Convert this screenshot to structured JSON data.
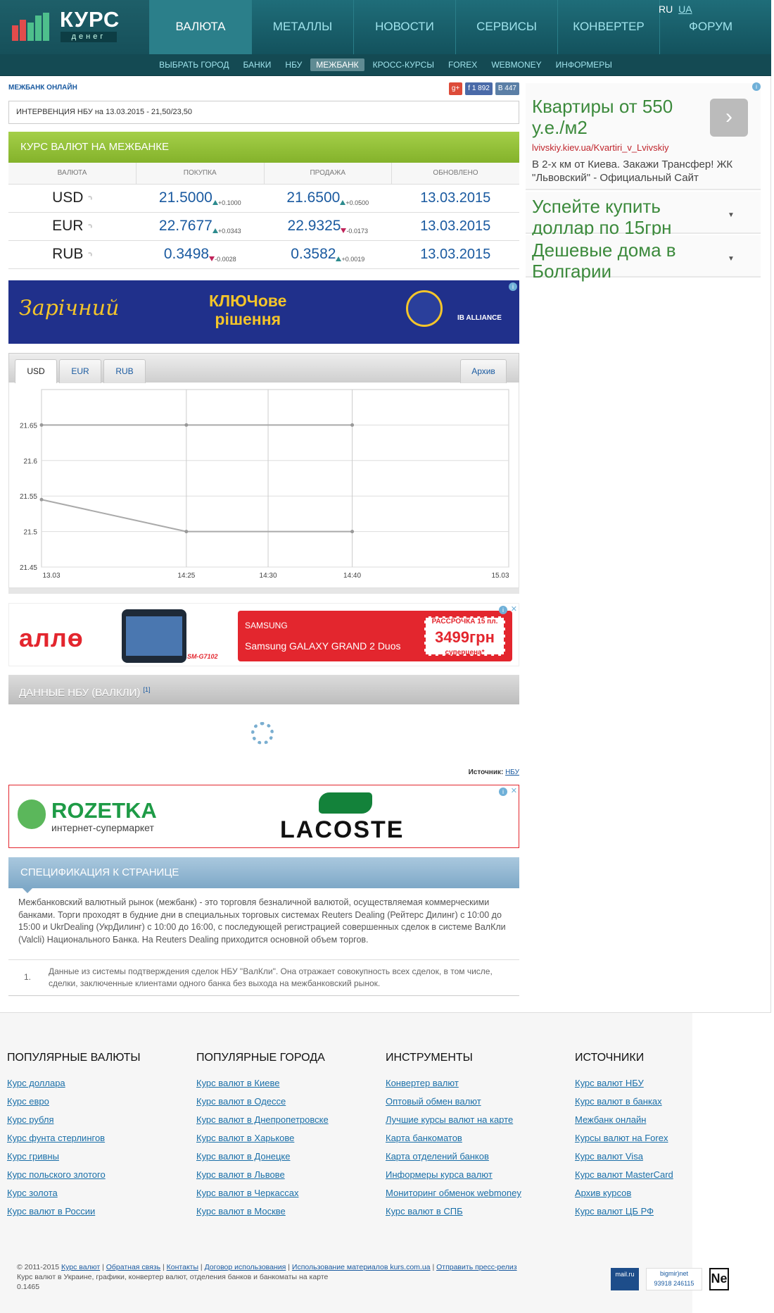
{
  "header": {
    "logo_text": "КУРС",
    "logo_sub": "денег",
    "nav": [
      "ВАЛЮТА",
      "МЕТАЛЛЫ",
      "НОВОСТИ",
      "СЕРВИСЫ",
      "КОНВЕРТЕР",
      "ФОРУМ"
    ],
    "lang_ru": "RU",
    "lang_ua": "UA",
    "subnav": [
      "ВЫБРАТЬ ГОРОД",
      "БАНКИ",
      "НБУ",
      "МЕЖБАНК",
      "КРОСС-КУРСЫ",
      "FOREX",
      "WEBMONEY",
      "ИНФОРМЕРЫ"
    ]
  },
  "main": {
    "section_title": "МЕЖБАНК ОНЛАЙН",
    "social": {
      "gplus": "g+",
      "fb": "f 1 892",
      "vk": "В 447"
    },
    "intervention": "ИНТЕРВЕНЦИЯ НБУ на 13.03.2015 - 21,50/23,50",
    "rates_title": "КУРС ВАЛЮТ НА МЕЖБАНКЕ",
    "columns": [
      "ВАЛЮТА",
      "ПОКУПКА",
      "ПРОДАЖА",
      "ОБНОВЛЕНО"
    ],
    "rows": [
      {
        "cur": "USD",
        "buy": "21.5000",
        "buy_chg": "+0.1000",
        "sell": "21.6500",
        "sell_chg": "+0.0500",
        "date": "13.03.2015"
      },
      {
        "cur": "EUR",
        "buy": "22.7677",
        "buy_chg": "+0.0343",
        "sell": "22.9325",
        "sell_chg": "-0.0173",
        "date": "13.03.2015"
      },
      {
        "cur": "RUB",
        "buy": "0.3498",
        "buy_chg": "-0.0028",
        "sell": "0.3582",
        "sell_chg": "+0.0019",
        "date": "13.03.2015"
      }
    ],
    "ad_zar": {
      "brand": "Зарічний",
      "slogan1": "КЛЮЧове",
      "slogan2": "рішення",
      "partner": "IB ALLIANCE"
    },
    "chart_tabs": [
      "USD",
      "EUR",
      "RUB"
    ],
    "archive": "Архив",
    "ad_allo": {
      "brand": "аллө",
      "model": "SM-G7102",
      "samsung": "SAMSUNG",
      "galaxy": "Samsung GALAXY GRAND 2 Duos",
      "promo": "РАССРОЧКА 15 пл.",
      "price": "3499грн",
      "price_note": "суперцена*"
    },
    "nbu_title": "ДАННЫЕ НБУ (ВАЛКЛИ)",
    "nbu_sup": "[1]",
    "source_label": "Источник:",
    "source_link": "НБУ",
    "ad_roz": {
      "brand": "ROZETKA",
      "sub": "интернет-супермаркет",
      "partner": "LACOSTE"
    },
    "spec_title": "СПЕЦИФИКАЦИЯ К СТРАНИЦЕ",
    "spec_text": "Межбанковский валютный рынок (межбанк) - это торговля безналичной валютой, осуществляемая коммерческими банками. Торги проходят в будние дни в специальных торговых системах Reuters Dealing (Рейтерс Дилинг) с 10:00 до 15:00 и UkrDealing (УкрДилинг) с 10:00 до 16:00, с последующей регистрацией совершенных сделок в системе ВалКли (Valcli) Национального Банка. На Reuters Dealing приходится основной объем торгов.",
    "spec_note_num": "1.",
    "spec_note": "Данные из системы подтверждения сделок НБУ \"ВалКли\". Она отражает совокупность всех сделок, в том числе, сделки, заключенные клиентами одного банка без выхода на межбанковский рынок."
  },
  "chart_data": {
    "type": "line",
    "x": [
      "13.03",
      "14:25",
      "14:30",
      "14:40",
      "15.03"
    ],
    "series": [
      {
        "values": [
          21.65,
          21.65,
          null,
          21.65,
          null
        ]
      },
      {
        "values": [
          21.545,
          21.5,
          null,
          21.5,
          null
        ]
      }
    ],
    "y_ticks": [
      21.45,
      21.5,
      21.55,
      21.6,
      21.65
    ],
    "ylim": [
      21.45,
      21.7
    ],
    "grid": true
  },
  "ads": {
    "ad1_title": "Квартиры от 550 у.е./м2",
    "ad1_url": "lvivskiy.kiev.ua/Kvartiri_v_Lvivskiy",
    "ad1_desc": "В 2-х км от Киева. Закажи Трансфер! ЖК \"Львовский\" - Официальный Сайт",
    "ad2_title": "Успейте купить доллар по 15грн",
    "ad3_title": "Дешевые дома в Болгарии"
  },
  "footer": {
    "col1_title": "ПОПУЛЯРНЫЕ ВАЛЮТЫ",
    "col1": [
      "Курс доллара",
      "Курс евро",
      "Курс рубля",
      "Курс фунта стерлингов",
      "Курс гривны",
      "Курс польского злотого",
      "Курс золота",
      "Курс валют в России"
    ],
    "col2_title": "ПОПУЛЯРНЫЕ ГОРОДА",
    "col2": [
      "Курс валют в Киеве",
      "Курс валют в Одессе",
      "Курс валют в Днепропетровске",
      "Курс валют в Харькове",
      "Курс валют в Донецке",
      "Курс валют в Львове",
      "Курс валют в Черкассах",
      "Курс валют в Москве"
    ],
    "col3_title": "ИНСТРУМЕНТЫ",
    "col3": [
      "Конвертер валют",
      "Оптовый обмен валют",
      "Лучшие курсы валют на карте",
      "Карта банкоматов",
      "Карта отделений банков",
      "Информеры курса валют",
      "Мониторинг обменок webmoney",
      "Курс валют в СПБ"
    ],
    "col4_title": "ИСТОЧНИКИ",
    "col4": [
      "Курс валют НБУ",
      "Курс валют в банках",
      "Межбанк онлайн",
      "Курсы валют на Forex",
      "Курс валют Visa",
      "Курс валют MasterCard",
      "Архив курсов",
      "Курс валют ЦБ РФ"
    ],
    "copyright_prefix": "© 2011-2015",
    "copy_links": [
      "Курс валют",
      "Обратная связь",
      "Контакты",
      "Договор использования",
      "Использование материалов kurs.com.ua",
      "Отправить пресс-релиз"
    ],
    "copy_line2": "Курс валют в Украине, графики, конвертер валют, отделения банков и банкоматы на карте",
    "copy_line3": "0.1465",
    "counter1": "mail.ru",
    "counter2": "bigmir)net",
    "counter2_a": "93918",
    "counter2_b": "246115",
    "counter3": "Ne"
  }
}
